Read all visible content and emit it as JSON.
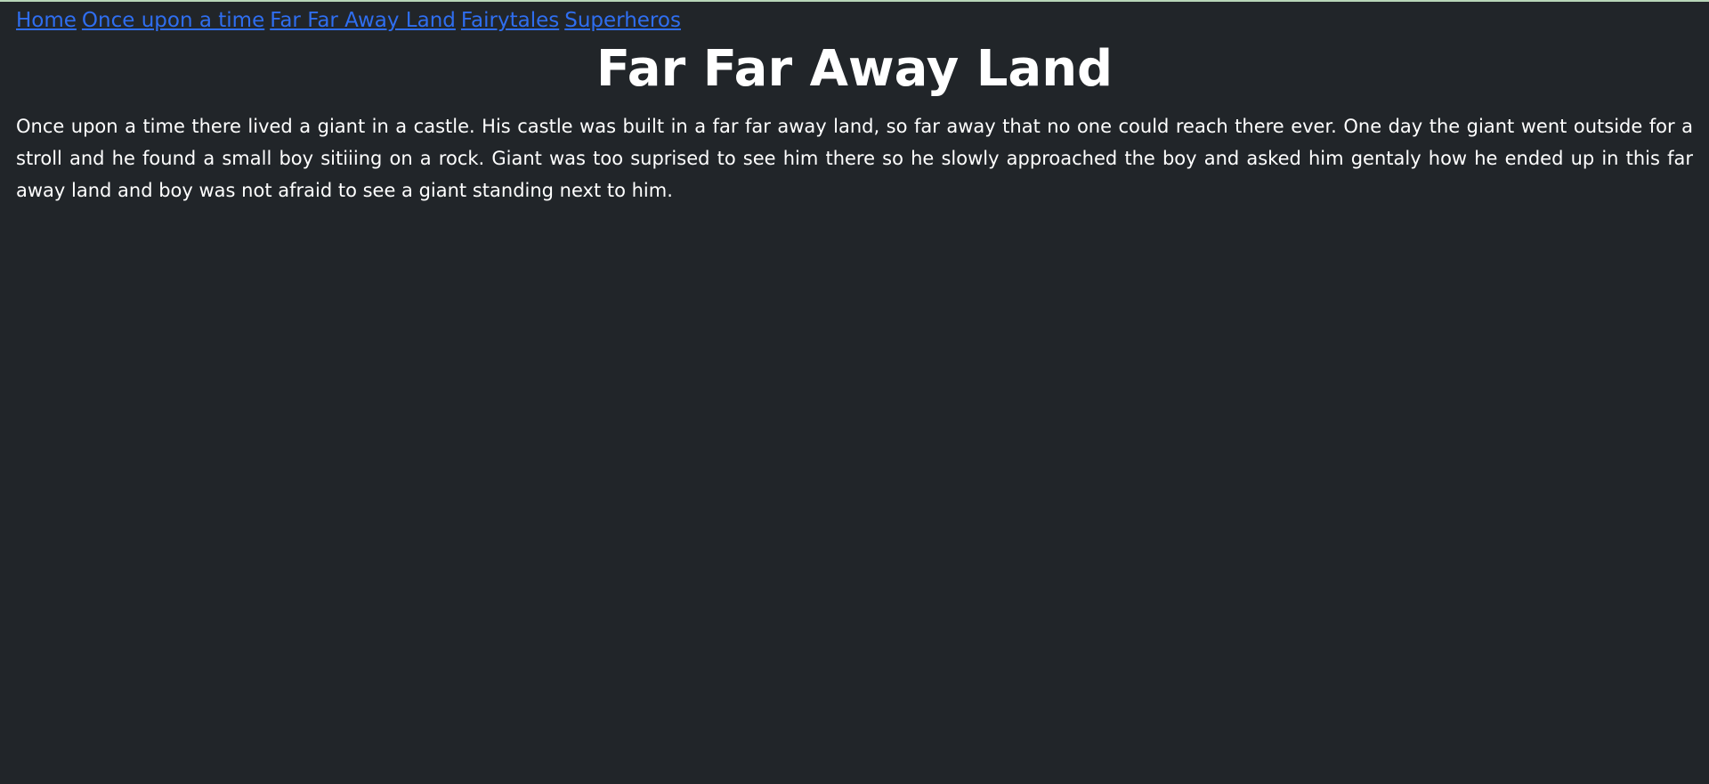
{
  "nav": {
    "links": [
      {
        "label": "Home"
      },
      {
        "label": "Once upon a time"
      },
      {
        "label": "Far Far Away Land"
      },
      {
        "label": "Fairytales"
      },
      {
        "label": "Superheros"
      }
    ]
  },
  "main": {
    "title": "Far Far Away Land",
    "paragraph": "Once upon a time there lived a giant in a castle. His castle was built in a far far away land, so far away that no one could reach there ever. One day the giant went outside for a stroll and he found a small boy sitiiing on a rock. Giant was too suprised to see him there so he slowly approached the boy and asked him gentaly how he ended up in this far away land and boy was not afraid to see a giant standing next to him."
  },
  "colors": {
    "background": "#212529",
    "link": "#2f6ef0",
    "text": "#ffffff"
  }
}
